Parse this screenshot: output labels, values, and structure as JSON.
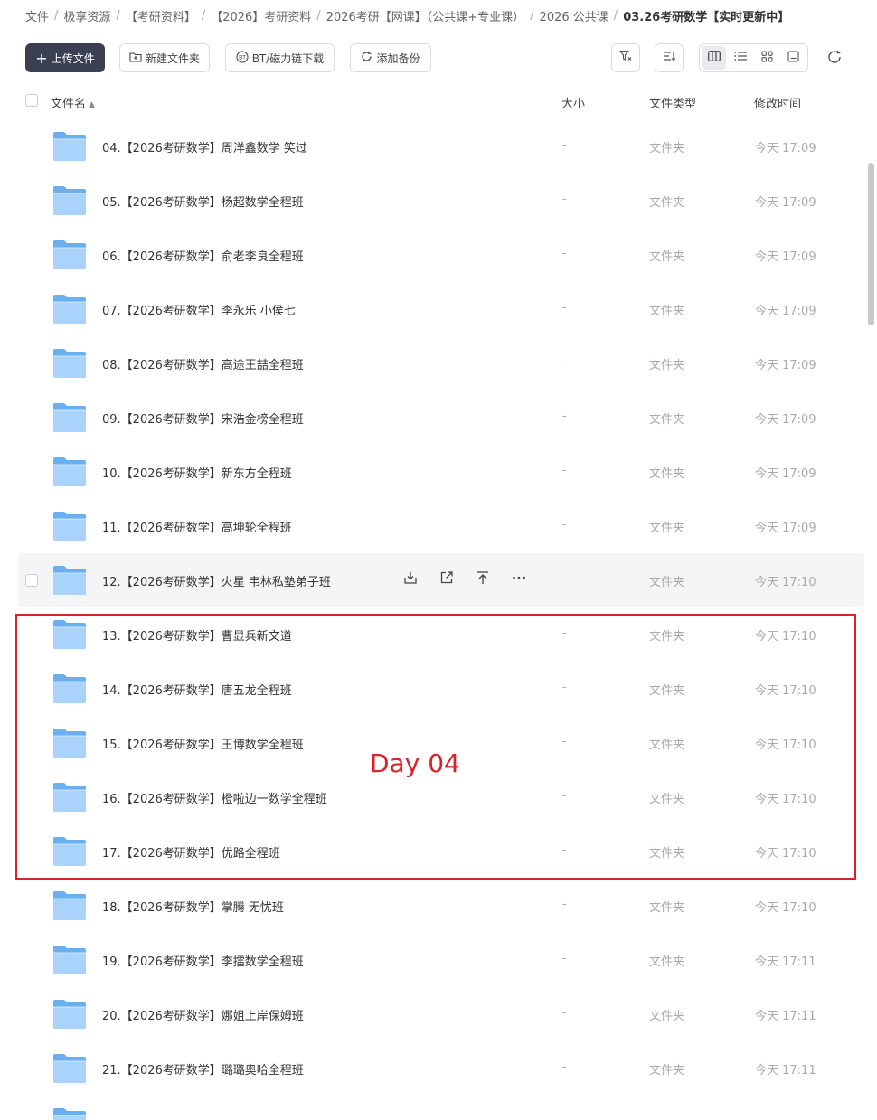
{
  "breadcrumb": [
    {
      "label": "文件"
    },
    {
      "label": "极享资源"
    },
    {
      "label": "【考研资料】"
    },
    {
      "label": "【2026】考研资料"
    },
    {
      "label": "2026考研【网课】（公共课+专业课）"
    },
    {
      "label": "2026 公共课"
    },
    {
      "label": "03.26考研数学【实时更新中】"
    }
  ],
  "breadcrumb_sep": "/",
  "toolbar": {
    "upload_label": "上传文件",
    "new_folder_label": "新建文件夹",
    "bt_label": "BT/磁力链下载",
    "backup_label": "添加备份"
  },
  "table": {
    "headers": {
      "name": "文件名",
      "size": "大小",
      "type": "文件类型",
      "mtime": "修改时间"
    }
  },
  "rows": [
    {
      "name": "04.【2026考研数学】周洋鑫数学 笑过",
      "size": "-",
      "type": "文件夹",
      "mtime": "今天 17:09"
    },
    {
      "name": "05.【2026考研数学】杨超数学全程班",
      "size": "-",
      "type": "文件夹",
      "mtime": "今天 17:09"
    },
    {
      "name": "06.【2026考研数学】俞老李良全程班",
      "size": "-",
      "type": "文件夹",
      "mtime": "今天 17:09"
    },
    {
      "name": "07.【2026考研数学】李永乐 小侯七",
      "size": "-",
      "type": "文件夹",
      "mtime": "今天 17:09"
    },
    {
      "name": "08.【2026考研数学】高途王喆全程班",
      "size": "-",
      "type": "文件夹",
      "mtime": "今天 17:09"
    },
    {
      "name": "09.【2026考研数学】宋浩金榜全程班",
      "size": "-",
      "type": "文件夹",
      "mtime": "今天 17:09"
    },
    {
      "name": "10.【2026考研数学】新东方全程班",
      "size": "-",
      "type": "文件夹",
      "mtime": "今天 17:09"
    },
    {
      "name": "11.【2026考研数学】高坤轮全程班",
      "size": "-",
      "type": "文件夹",
      "mtime": "今天 17:09"
    },
    {
      "name": "12.【2026考研数学】火星 韦林私塾弟子班",
      "size": "-",
      "type": "文件夹",
      "mtime": "今天 17:10"
    },
    {
      "name": "13.【2026考研数学】曹显兵新文道",
      "size": "-",
      "type": "文件夹",
      "mtime": "今天 17:10"
    },
    {
      "name": "14.【2026考研数学】唐五龙全程班",
      "size": "-",
      "type": "文件夹",
      "mtime": "今天 17:10"
    },
    {
      "name": "15.【2026考研数学】王博数学全程班",
      "size": "-",
      "type": "文件夹",
      "mtime": "今天 17:10"
    },
    {
      "name": "16.【2026考研数学】橙啦边一数学全程班",
      "size": "-",
      "type": "文件夹",
      "mtime": "今天 17:10"
    },
    {
      "name": "17.【2026考研数学】优路全程班",
      "size": "-",
      "type": "文件夹",
      "mtime": "今天 17:10"
    },
    {
      "name": "18.【2026考研数学】掌腾 无忧班",
      "size": "-",
      "type": "文件夹",
      "mtime": "今天 17:10"
    },
    {
      "name": "19.【2026考研数学】李擂数学全程班",
      "size": "-",
      "type": "文件夹",
      "mtime": "今天 17:11"
    },
    {
      "name": "20.【2026考研数学】娜姐上岸保姆班",
      "size": "-",
      "type": "文件夹",
      "mtime": "今天 17:11"
    },
    {
      "name": "21.【2026考研数学】璐璐奥哈全程班",
      "size": "-",
      "type": "文件夹",
      "mtime": "今天 17:11"
    },
    {
      "name": "",
      "size": "",
      "type": "",
      "mtime": ""
    }
  ],
  "hovered_row": 8,
  "annotation": {
    "label": "Day 04",
    "color": "#d9222a"
  },
  "colors": {
    "folder": "#6ab0f0",
    "folder_light": "#a9d3fb",
    "primary_button": "#3a3f51"
  }
}
